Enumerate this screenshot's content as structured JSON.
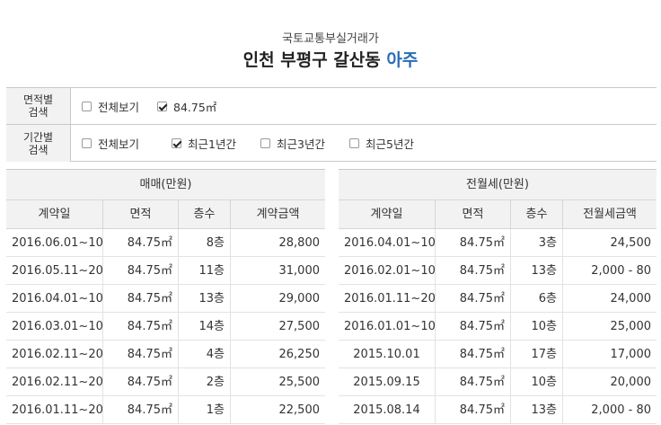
{
  "header": {
    "subtitle": "국토교통부실거래가",
    "title_main": "인천 부평구 갈산동",
    "title_accent": "아주"
  },
  "filters": {
    "area": {
      "label": "면적별 검색",
      "options": [
        {
          "label": "전체보기",
          "checked": false
        },
        {
          "label": "84.75㎡",
          "checked": true
        }
      ]
    },
    "period": {
      "label": "기간별 검색",
      "options": [
        {
          "label": "전체보기",
          "checked": false
        },
        {
          "label": "최근1년간",
          "checked": true
        },
        {
          "label": "최근3년간",
          "checked": false
        },
        {
          "label": "최근5년간",
          "checked": false
        }
      ]
    }
  },
  "sale": {
    "caption": "매매(만원)",
    "headers": [
      "계약일",
      "면적",
      "층수",
      "계약금액"
    ],
    "rows": [
      [
        "2016.06.01~10",
        "84.75㎡",
        "8층",
        "28,800"
      ],
      [
        "2016.05.11~20",
        "84.75㎡",
        "11층",
        "31,000"
      ],
      [
        "2016.04.01~10",
        "84.75㎡",
        "13층",
        "29,000"
      ],
      [
        "2016.03.01~10",
        "84.75㎡",
        "14층",
        "27,500"
      ],
      [
        "2016.02.11~20",
        "84.75㎡",
        "4층",
        "26,250"
      ],
      [
        "2016.02.11~20",
        "84.75㎡",
        "2층",
        "25,500"
      ],
      [
        "2016.01.11~20",
        "84.75㎡",
        "1층",
        "22,500"
      ]
    ]
  },
  "rent": {
    "caption": "전월세(만원)",
    "headers": [
      "계약일",
      "면적",
      "층수",
      "전월세금액"
    ],
    "rows": [
      [
        "2016.04.01~10",
        "84.75㎡",
        "3층",
        "24,500"
      ],
      [
        "2016.02.01~10",
        "84.75㎡",
        "13층",
        "2,000 - 80"
      ],
      [
        "2016.01.11~20",
        "84.75㎡",
        "6층",
        "24,000"
      ],
      [
        "2016.01.01~10",
        "84.75㎡",
        "10층",
        "25,000"
      ],
      [
        "2015.10.01",
        "84.75㎡",
        "17층",
        "17,000"
      ],
      [
        "2015.09.15",
        "84.75㎡",
        "10층",
        "20,000"
      ],
      [
        "2015.08.14",
        "84.75㎡",
        "13층",
        "2,000 - 80"
      ]
    ]
  }
}
